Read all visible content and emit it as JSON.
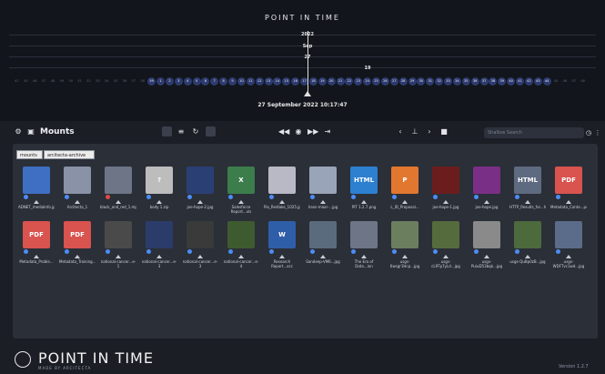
{
  "app": {
    "title": "POINT IN TIME",
    "brand_name": "POINT IN TIME",
    "brand_sub": "MADE BY ARCITECTA",
    "version": "Version 1.2.7"
  },
  "timeline": {
    "year": "2022",
    "month": "Sep",
    "day": "27",
    "marker": "19",
    "current": "27 September 2022 10:17:47",
    "days": [
      "41",
      "45",
      "46",
      "47",
      "48",
      "49",
      "50",
      "51",
      "52",
      "53",
      "54",
      "55",
      "56",
      "57",
      "58",
      "59",
      "1",
      "2",
      "3",
      "4",
      "5",
      "6",
      "7",
      "8",
      "9",
      "10",
      "11",
      "12",
      "13",
      "14",
      "15",
      "16",
      "17",
      "18",
      "19",
      "20",
      "21",
      "22",
      "23",
      "24",
      "25",
      "26",
      "27",
      "28",
      "29",
      "30",
      "31",
      "32",
      "33",
      "34",
      "35",
      "36",
      "37",
      "38",
      "39",
      "40",
      "41",
      "42",
      "43",
      "44",
      "45",
      "46",
      "47",
      "48"
    ],
    "days_active_from": 15
  },
  "toolbar": {
    "mounts_label": "Mounts",
    "search_placeholder": "Shallow Search",
    "icons": [
      "grid-view-icon",
      "list-view-icon",
      "refresh-icon",
      "copy-icon",
      "rewind-icon",
      "play-icon",
      "fast-forward-icon",
      "skip-end-icon",
      "prev-icon",
      "pin-icon",
      "next-icon",
      "folder-icon",
      "search-icon",
      "clock-icon",
      "more-icon"
    ]
  },
  "breadcrumb": {
    "items": [
      "mounts",
      "arcitecta-archive"
    ]
  },
  "files": [
    {
      "name": "ADNET_mediaInfo.jpg",
      "type": "image",
      "color": "#3f6fc2",
      "badge": "blue"
    },
    {
      "name": "Arcitecta_1",
      "type": "folder",
      "color": "#8a92a8",
      "badge": "blue"
    },
    {
      "name": "black_and_red_1.mp4",
      "type": "video",
      "color": "#6d7587",
      "badge": "red"
    },
    {
      "name": "body 1.zip",
      "type": "zip",
      "color": "#bdbdbd",
      "badge": "blue"
    },
    {
      "name": "joe-hope-2.jpg",
      "type": "image",
      "color": "#2a3f74",
      "badge": "blue"
    },
    {
      "name": "Salesforce Report...xls",
      "type": "xls",
      "color": "#3c7d4c",
      "badge": "blue"
    },
    {
      "name": "Pia_Redlake_1025.jpeg",
      "type": "image",
      "color": "#b9b9c6",
      "badge": "blue"
    },
    {
      "name": "hans-maar-...jpg",
      "type": "image",
      "color": "#9aa4b8",
      "badge": "blue"
    },
    {
      "name": "PIT 1.2.7.png",
      "type": "html",
      "color": "#2d7fd0",
      "badge": "blue"
    },
    {
      "name": "L_ID_Proposal...",
      "type": "ppt",
      "color": "#e2772f",
      "badge": "blue"
    },
    {
      "name": "joe-hope-1.jpg",
      "type": "image",
      "color": "#6b1d1d",
      "badge": "blue"
    },
    {
      "name": "joe-hope.jpg",
      "type": "image",
      "color": "#7a2f86",
      "badge": "blue"
    },
    {
      "name": "HTTP_Results_for...htm",
      "type": "html",
      "color": "#5e6a80",
      "badge": "blue"
    },
    {
      "name": "Metadata_Conte...pdf",
      "type": "pdf",
      "color": "#d9534f",
      "badge": "blue"
    },
    {
      "name": "Metadata_Proble...",
      "type": "pdf",
      "color": "#d9534f",
      "badge": "blue"
    },
    {
      "name": "Metadata_Training...",
      "type": "pdf",
      "color": "#d9534f",
      "badge": "blue"
    },
    {
      "name": "national-cancer...e-1",
      "type": "image",
      "color": "#4a4a4a",
      "badge": "blue"
    },
    {
      "name": "national-cancer...e-3",
      "type": "image",
      "color": "#2b3c6b",
      "badge": "blue"
    },
    {
      "name": "national-cancer...e-3",
      "type": "image",
      "color": "#3a3a3a",
      "badge": "blue"
    },
    {
      "name": "national-cancer...e-4",
      "type": "image",
      "color": "#3e5b2f",
      "badge": "blue"
    },
    {
      "name": "Research Report...xcc",
      "type": "doc",
      "color": "#2f5ea8",
      "badge": "blue"
    },
    {
      "name": "Sandeep-VM6...jpg",
      "type": "image",
      "color": "#5a6b7e",
      "badge": "blue"
    },
    {
      "name": "The Era of Data...ion",
      "type": "video",
      "color": "#6d7587",
      "badge": "blue"
    },
    {
      "name": "usgs-6wsgr1Hcp...jpg",
      "type": "image",
      "color": "#6b7f5f",
      "badge": "blue"
    },
    {
      "name": "usgs-cL9Tp7yLd...jpg",
      "type": "image",
      "color": "#556b3e",
      "badge": "blue"
    },
    {
      "name": "usgs-PuiuD53bqk...jpg",
      "type": "image",
      "color": "#8a8a8a",
      "badge": "blue"
    },
    {
      "name": "usgs-QuBp0zB...jpg",
      "type": "image",
      "color": "#4c6a3c",
      "badge": "blue"
    },
    {
      "name": "usgs-WDFTvc1wd...jpg",
      "type": "image",
      "color": "#5b6c8a",
      "badge": "blue"
    }
  ]
}
